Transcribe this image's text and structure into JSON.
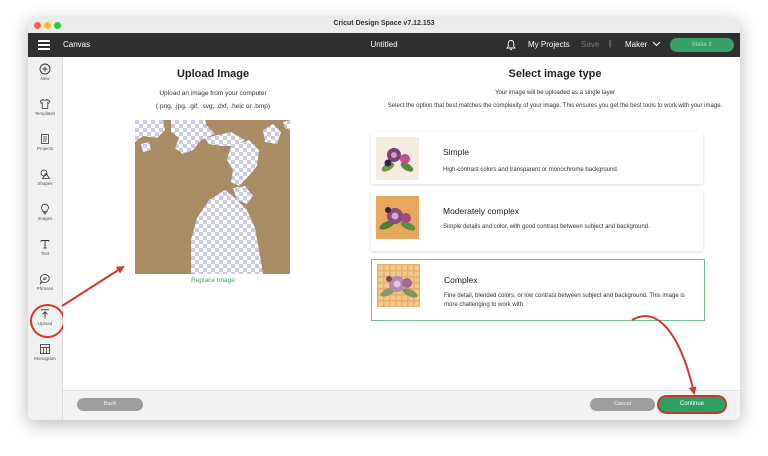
{
  "window": {
    "title": "Cricut Design Space  v7.12.153"
  },
  "topbar": {
    "canvas_label": "Canvas",
    "document_title": "Untitled",
    "my_projects": "My Projects",
    "save": "Save",
    "separator": "|",
    "machine": "Maker",
    "make_it": "Make It"
  },
  "sidebar": {
    "items": [
      {
        "label": "New",
        "icon": "plus-circle-icon"
      },
      {
        "label": "Templates",
        "icon": "shirt-icon"
      },
      {
        "label": "Projects",
        "icon": "projects-icon"
      },
      {
        "label": "Shapes",
        "icon": "shapes-icon"
      },
      {
        "label": "Images",
        "icon": "lightbulb-icon"
      },
      {
        "label": "Text",
        "icon": "text-icon"
      },
      {
        "label": "Phrases",
        "icon": "speech-bubble-icon"
      },
      {
        "label": "Upload",
        "icon": "upload-icon"
      },
      {
        "label": "Monogram",
        "icon": "monogram-icon"
      }
    ]
  },
  "upload": {
    "title": "Upload Image",
    "instruction": "Upload an image from your computer",
    "formats": "(.png, .jpg, .gif, .svg, .dxf, .heic or .bmp)",
    "replace_label": "Replace Image"
  },
  "image_type": {
    "title": "Select image type",
    "note": "Your image will be uploaded as a single layer",
    "instruction": "Select the option that best matches the complexity of your image. This ensures you get the best tools to work with your image.",
    "options": [
      {
        "title": "Simple",
        "description": "High-contrast colors and transparent or monochrome background.",
        "selected": false
      },
      {
        "title": "Moderately complex",
        "description": "Simple details and color, with good contrast between subject and background.",
        "selected": false
      },
      {
        "title": "Complex",
        "description": "Fine detail, blended colors, or low contrast between subject and background. This image is more challenging to work with.",
        "selected": true
      }
    ]
  },
  "footer": {
    "back": "Back",
    "cancel": "Cancel",
    "continue": "Continue"
  },
  "colors": {
    "accent_green": "#2f9e63",
    "annotation_red": "#d23a2a",
    "image_background": "#a98c64",
    "topbar": "#2f2f2f"
  }
}
